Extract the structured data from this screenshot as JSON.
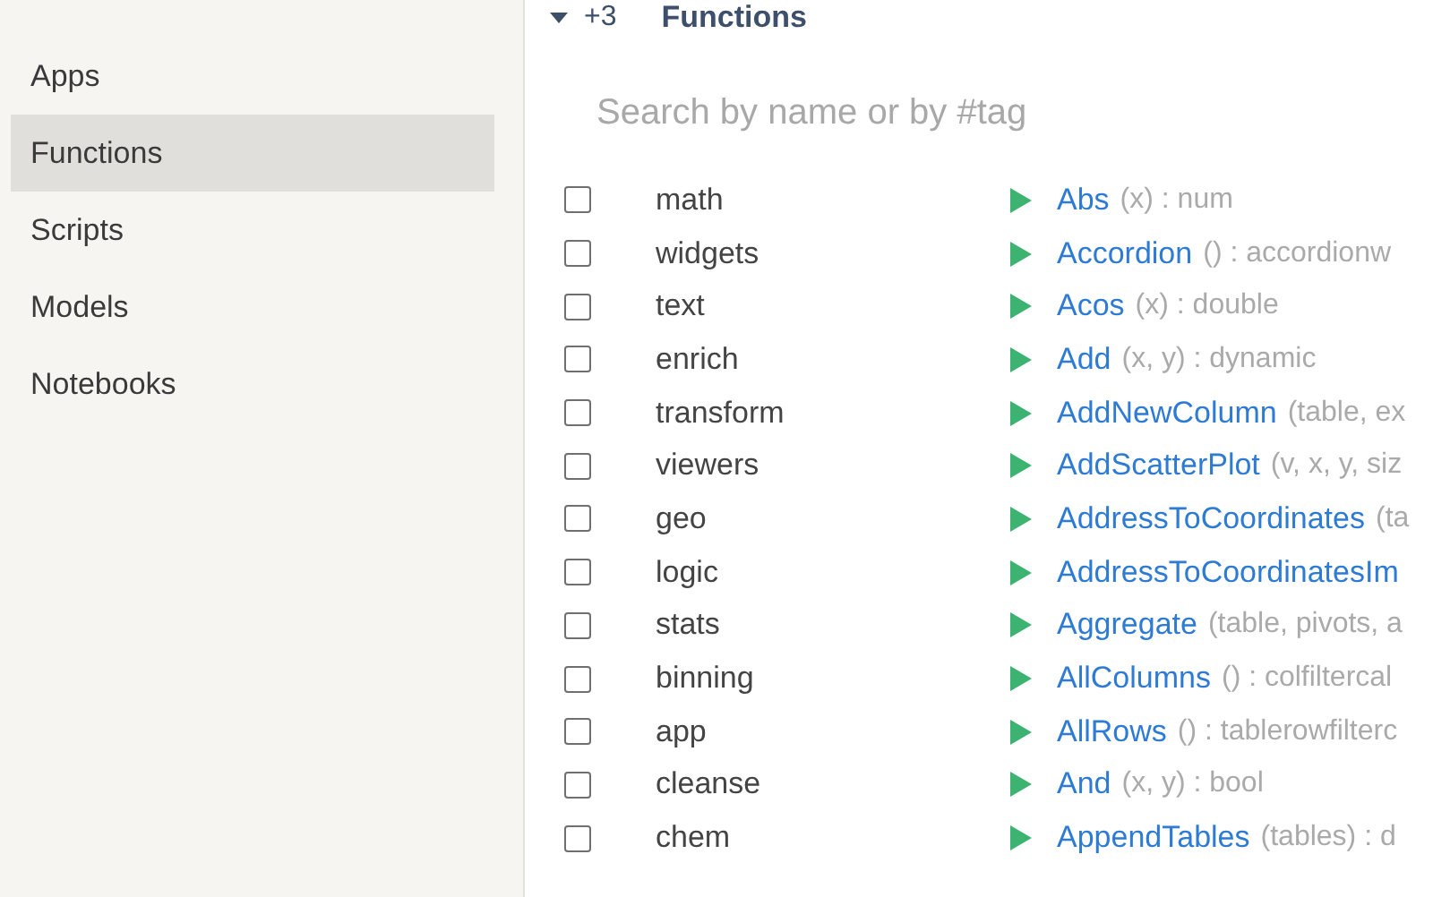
{
  "sidebar": {
    "items": [
      {
        "label": "Apps",
        "selected": false
      },
      {
        "label": "Functions",
        "selected": true
      },
      {
        "label": "Scripts",
        "selected": false
      },
      {
        "label": "Models",
        "selected": false
      },
      {
        "label": "Notebooks",
        "selected": false
      }
    ]
  },
  "header": {
    "count": "+3",
    "title": "Functions",
    "expanded": true
  },
  "search": {
    "placeholder": "Search by name or by #tag"
  },
  "tags": [
    {
      "label": "math",
      "checked": false
    },
    {
      "label": "widgets",
      "checked": false
    },
    {
      "label": "text",
      "checked": false
    },
    {
      "label": "enrich",
      "checked": false
    },
    {
      "label": "transform",
      "checked": false
    },
    {
      "label": "viewers",
      "checked": false
    },
    {
      "label": "geo",
      "checked": false
    },
    {
      "label": "logic",
      "checked": false
    },
    {
      "label": "stats",
      "checked": false
    },
    {
      "label": "binning",
      "checked": false
    },
    {
      "label": "app",
      "checked": false
    },
    {
      "label": "cleanse",
      "checked": false
    },
    {
      "label": "chem",
      "checked": false
    }
  ],
  "functions": [
    {
      "name": "Abs",
      "signature": "(x) : num"
    },
    {
      "name": "Accordion",
      "signature": "() : accordionw"
    },
    {
      "name": "Acos",
      "signature": "(x) : double"
    },
    {
      "name": "Add",
      "signature": "(x, y) : dynamic"
    },
    {
      "name": "AddNewColumn",
      "signature": "(table, ex"
    },
    {
      "name": "AddScatterPlot",
      "signature": "(v, x, y, siz"
    },
    {
      "name": "AddressToCoordinates",
      "signature": "(ta"
    },
    {
      "name": "AddressToCoordinatesIm"
    },
    {
      "name": "Aggregate",
      "signature": "(table, pivots, a"
    },
    {
      "name": "AllColumns",
      "signature": "() : colfiltercal"
    },
    {
      "name": "AllRows",
      "signature": "() : tablerowfilterc"
    },
    {
      "name": "And",
      "signature": "(x, y) : bool"
    },
    {
      "name": "AppendTables",
      "signature": "(tables) : d"
    }
  ]
}
